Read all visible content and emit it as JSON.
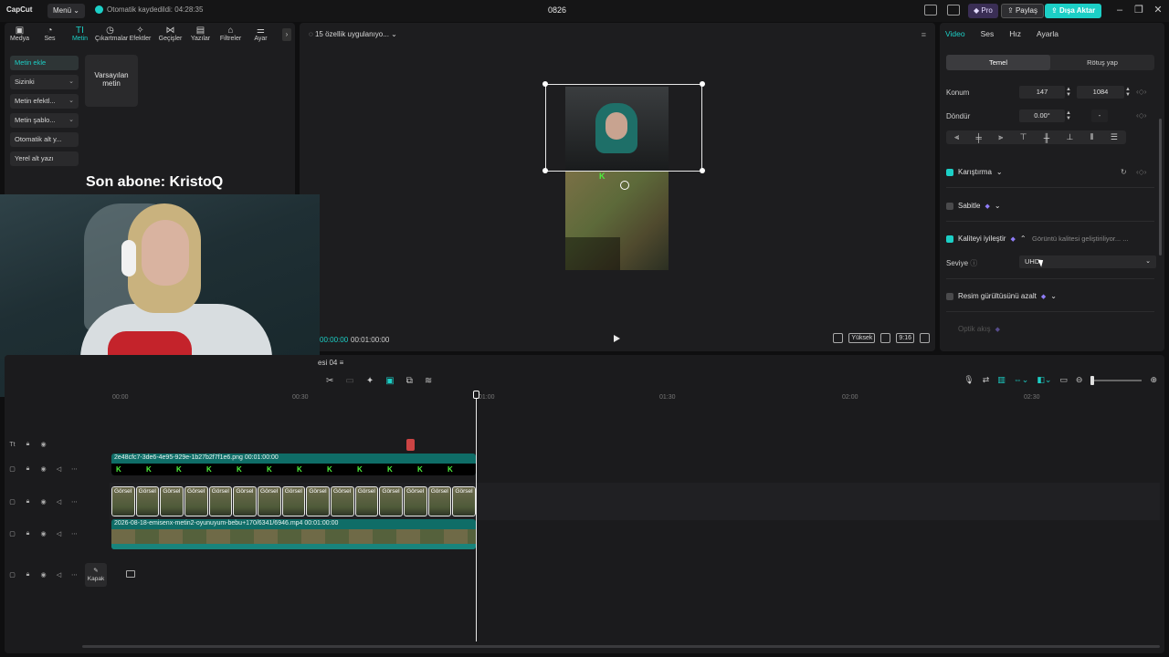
{
  "app": {
    "logo": "CapCut",
    "menu_label": "Menü",
    "autosave": "Otomatik kaydedildi: 04:28:35",
    "title": "0826",
    "pro_label": "Pro",
    "share_label": "Paylaş",
    "export_label": "Dışa Aktar"
  },
  "toolbar": {
    "tabs": [
      "Medya",
      "Ses",
      "Metin",
      "Çıkartmalar",
      "Efektler",
      "Geçişler",
      "Yazılar",
      "Filtreler",
      "Ayar"
    ],
    "active": "Metin"
  },
  "text_panel": {
    "items": [
      "Metin ekle",
      "Sizinki",
      "Metin efektl...",
      "Metin şablo...",
      "Otomatik alt y...",
      "Yerel alt yazı"
    ],
    "default_card": "Varsayılan metin",
    "subscriber": "Son abone: KristoQ"
  },
  "preview": {
    "status": "15 özellik uygulanıyo...",
    "time_current": "00:00:00",
    "time_total": "00:01:00:00",
    "quality_label": "Yüksek",
    "ratio_label": "9:16",
    "logo_k": "K"
  },
  "inspector": {
    "tabs": [
      "Video",
      "Ses",
      "Hız",
      "Ayarla"
    ],
    "segments": [
      "Temel",
      "Rötuş yap"
    ],
    "position_label": "Konum",
    "pos_x_tag": "X",
    "pos_x": "147",
    "pos_y_tag": "Y",
    "pos_y": "1084",
    "rotate_label": "Döndür",
    "rotate_value": "0.00°",
    "rotate_mirror": "-",
    "blend_label": "Karıştırma",
    "stabilize_label": "Sabitle",
    "enhance_label": "Kaliteyi iyileştir",
    "enhance_status": "Görüntü kalitesi geliştiriliyor... ...",
    "level_label": "Seviye",
    "level_value": "UHD",
    "denoise_label": "Resim gürültüsünü azalt",
    "optical_label": "Optik akış"
  },
  "timeline": {
    "sequence_name": "esi 04",
    "ruler": [
      "00:00",
      "00:30",
      "01:00",
      "01:30",
      "02:00",
      "02:30"
    ],
    "image_clip": "2e48cfc7-3de6-4e95-929e-1b27b2f7f1e6.png   00:01:00:00",
    "thumb_label": "Görsel",
    "video_clip": "2026-08-18-emisenx-metin2-oyunuyum-bebu+170/6341/6946.mp4   00:01:00:00",
    "cover_label": "Kapak"
  }
}
